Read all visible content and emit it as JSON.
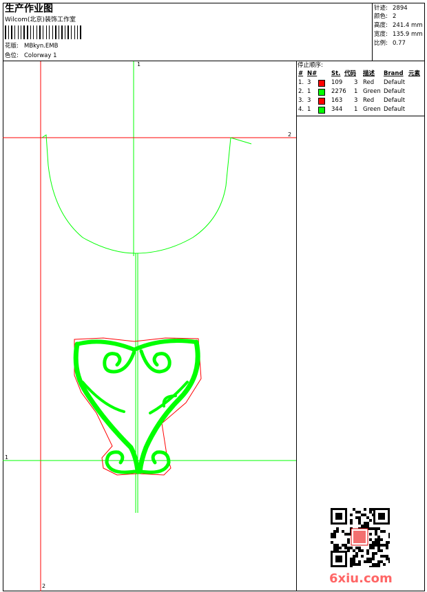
{
  "header": {
    "title": "生产作业图",
    "subtitle": "Wilcom(北京)装饰工作室",
    "design_label": "花版:",
    "design_value": "MBkyn.EMB",
    "colorway_label": "色位:",
    "colorway_value": "Colorway 1"
  },
  "stats": {
    "stitches_label": "针迹:",
    "stitches_value": "2894",
    "colors_label": "颜色:",
    "colors_value": "2",
    "height_label": "高度:",
    "height_value": "241.4 mm",
    "width_label": "宽度:",
    "width_value": "135.9 mm",
    "scale_label": "比例:",
    "scale_value": "0.77"
  },
  "stop_sequence": {
    "title": "停止顺序:",
    "columns": [
      "#",
      "N#",
      "St.",
      "代码",
      "描述",
      "Brand",
      "元素"
    ],
    "rows": [
      {
        "num": "1.",
        "n": "3",
        "color": "#ff0000",
        "st": "109",
        "code": "3",
        "desc": "Red",
        "brand": "Default"
      },
      {
        "num": "2.",
        "n": "1",
        "color": "#00ff00",
        "st": "2276",
        "code": "1",
        "desc": "Green",
        "brand": "Default"
      },
      {
        "num": "3.",
        "n": "3",
        "color": "#ff0000",
        "st": "163",
        "code": "3",
        "desc": "Red",
        "brand": "Default"
      },
      {
        "num": "4.",
        "n": "1",
        "color": "#00ff00",
        "st": "344",
        "code": "1",
        "desc": "Green",
        "brand": "Default"
      }
    ]
  },
  "axes": {
    "v_green": "1",
    "h_red": "2",
    "h_green": "1",
    "v_red": "2"
  },
  "colors": {
    "red_guide": "#ff0000",
    "green_thread": "#00ff00",
    "red_thread": "#ff0000"
  },
  "watermark": {
    "site": "6xiu.com",
    "icon": "qr-code-icon"
  }
}
